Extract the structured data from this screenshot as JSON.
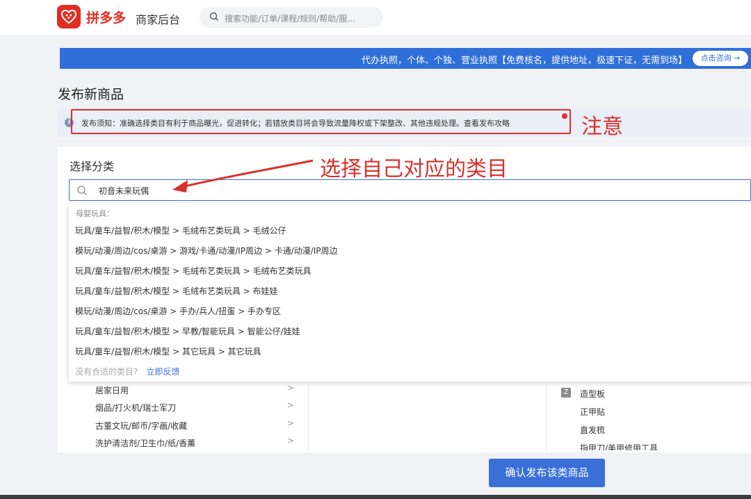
{
  "header": {
    "logo_text": "拼多多",
    "logo_sub": "商家后台",
    "search_placeholder": "搜索功能/订单/课程/规则/帮助/服..."
  },
  "banner": {
    "text": "代办执照，个体、个独、营业执照【免费核名，提供地址，极速下证，无需到场】",
    "button": "点击咨询 →",
    "color": "#2f6fd9"
  },
  "page_title": "发布新商品",
  "notice": {
    "text": "发布须知：准确选择类目有利于商品曝光，促进转化；若错放类目将会导致流量降权或下架整改、其他违规处理。",
    "link": "查看发布攻略"
  },
  "annotations": {
    "note1": "注意",
    "note2": "选择自己对应的类目",
    "color": "#d9302c"
  },
  "category": {
    "title": "选择分类",
    "search_value": "初音未来玩偶"
  },
  "dropdown": {
    "group": "母婴玩具：",
    "items": [
      "玩具/童车/益智/积木/模型 > 毛绒布艺类玩具 > 毛绒公仔",
      "模玩/动漫/周边/cos/桌游 > 游戏/卡通/动漫/IP周边 > 卡通/动漫/IP周边",
      "玩具/童车/益智/积木/模型 > 毛绒布艺类玩具 > 毛绒布艺类玩具",
      "玩具/童车/益智/积木/模型 > 毛绒布艺类玩具 > 布娃娃",
      "模玩/动漫/周边/cos/桌游 > 手办/兵人/扭蛋 > 手办专区",
      "玩具/童车/益智/积木/模型 > 早教/智能玩具 > 智能公仔/娃娃",
      "玩具/童车/益智/积木/模型 > 其它玩具 > 其它玩具"
    ],
    "footer_text": "没有合适的类目?",
    "footer_link": "立即反馈"
  },
  "left_list": [
    "居家日用",
    "烟品/打火机/瑞士军刀",
    "古董文玩/邮币/字画/收藏",
    "洗护清洁剂/卫生巾/纸/香薰"
  ],
  "right_list": {
    "badge": "Z",
    "items": [
      "造型板",
      "正甲贴",
      "直发梳",
      "指甲刀/美甲修甲工具"
    ]
  },
  "confirm_button": "确认发布该类商品",
  "accent_color": "#3a6fd8"
}
